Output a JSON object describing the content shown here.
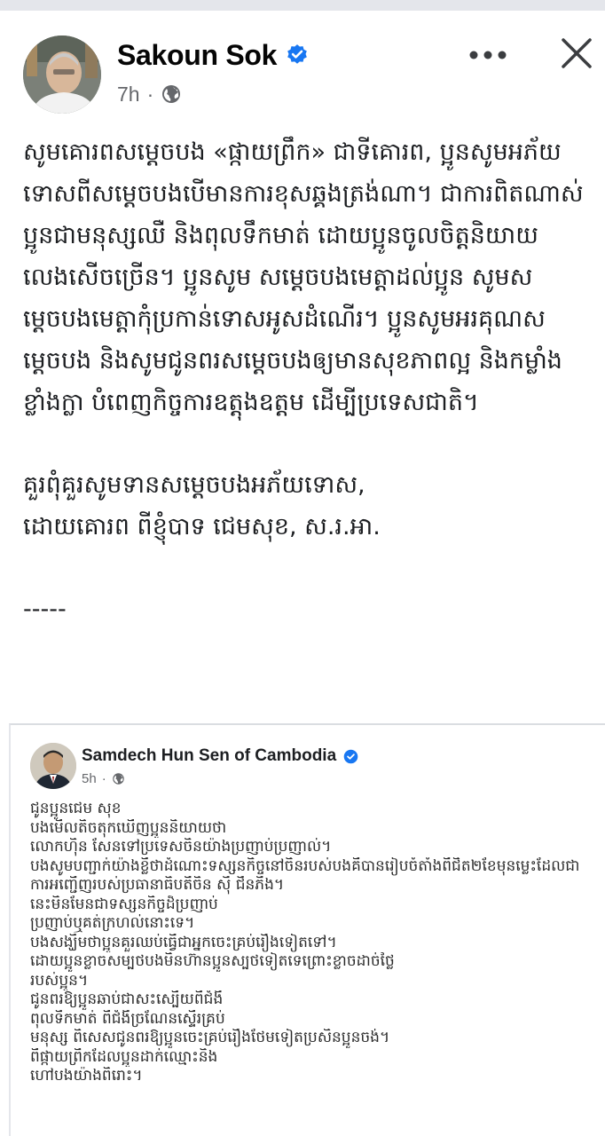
{
  "post": {
    "author": "Sakoun Sok",
    "time": "7h",
    "separator": "·",
    "paragraphs": [
      "សូមគោរពសម្តេចបង «ផ្កាយព្រឹក» ជាទីគោរព, ប្អូនសូមអភ័យទោសពីសម្តេចបងបើមានការខុសឆ្គងត្រង់ណា។ ជាការពិតណាស់ប្អូនជាមនុស្សឈឺ និងពុលទឹកមាត់ ដោយប្អូនចូលចិត្តនិយាយលេងសើចច្រើន។ ប្អូនសូម សម្តេចបងមេត្តាដល់ប្អូន សូមសម្តេចបងមេត្តាកុំប្រកាន់ទោសអូសដំណើរ។ ប្អូនសូមអរគុណសម្តេចបង និងសូមជូនពរសម្តេចបងឲ្យមានសុខភាពល្អ និងកម្លាំងខ្លាំងក្លា បំពេញកិច្ចការឧត្តុងឧត្តម ដើម្បីប្រទេសជាតិ។"
    ],
    "signoff_lines": [
      "គួរពុំគួរសូមទានសម្តេចបងអភ័យទោស,",
      "ដោយគោរព ពីខ្ញុំបាទ ជេមសុខ, ស.រ.អា."
    ],
    "divider": "-----"
  },
  "shared_post": {
    "author": "Samdech Hun Sen of Cambodia",
    "time": "5h",
    "separator": "·",
    "lines": [
      "ជូនប្អូនជេម សុខ",
      "បងមើលតិចតុកឃើញប្អូននិយាយថា",
      "លោកហ៊ិន សែនទៅប្រទេសចិនយ៉ាងប្រញាប់ប្រញាល់។",
      "បងសូមបញ្ជាក់យ៉ាងខ្លីថាដំណោះទស្សនកិច្ចនៅចិនរបស់បងគឺបានរៀបចំតាំងពីជិត២ខែមុនម្លេះដែលជា",
      "ការអញ្ជើញរបស់ប្រធានាធិបតីចិន  ស៊ី ជីនភីង។",
      "នេះមិនមែនជាទស្សនកិច្ចដ៏ប្រញាប់",
      "ប្រញាប់ឬគត់ក្រហល់នោះទេ។",
      "បងសង្ឃឹមថាប្អូនគួរឈប់ធ្វើជាអ្នកចេះគ្រប់រឿងទៀតទៅ។",
      "ដោយប្អូនខ្លាចសម្បថបងមិនហ៊ានប្អូនស្បថទៀតទេព្រោះខ្លាចដាច់ថ្លៃ",
      "របស់ប្អូន។",
      "ជូនពរឱ្យប្អូនឆាប់ជាសះស្បើយពីជំងឺ",
      "ពុលទឹកមាត់ ពីជំងឺច្រណែនស្ទើរគ្រប់",
      "មនុស្ស ពិសេសជូនពរឱ្យប្អូនចេះគ្រប់រឿងថែមទៀតប្រសិនប្អូនចង់។",
      "ពីផ្កាយព្រឹកដែលប្អូនដាក់ឈ្មោះនិង",
      "ហៅបងយ៉ាងពិរោះ។"
    ]
  },
  "icons": {
    "verified": "verified-check-icon",
    "audience": "globe-icon",
    "more": "more-options-icon",
    "close": "close-icon"
  },
  "colors": {
    "verified_blue": "#1877f2",
    "meta_gray": "#65676b",
    "text_dark": "#1c1e21"
  }
}
